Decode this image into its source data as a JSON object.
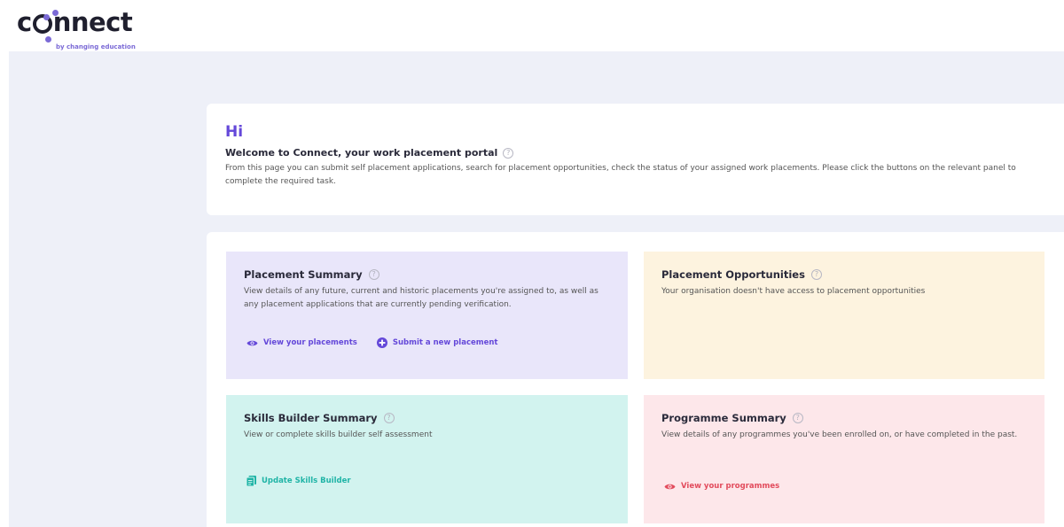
{
  "brand": {
    "logo_text_a": "c",
    "logo_text_b": "nnect",
    "tagline": "by changing education",
    "accent": "#6448d9"
  },
  "welcome": {
    "greeting": "Hi",
    "title": "Welcome to Connect, your work placement portal",
    "description": "From this page you can submit self placement applications, search for placement opportunities, check the status of your assigned work placements. Please click the buttons on the relevant panel to complete the required task."
  },
  "panels": {
    "placement_summary": {
      "title": "Placement Summary",
      "description": "View details of any future, current and historic placements you're assigned to, as well as any placement applications that are currently pending verification.",
      "actions": [
        {
          "label": "View your placements",
          "icon": "eye-icon"
        },
        {
          "label": "Submit a new placement",
          "icon": "plus-circle-icon"
        }
      ],
      "color": "#e9e6fa"
    },
    "placement_opportunities": {
      "title": "Placement Opportunities",
      "description": "Your organisation doesn't have access to placement opportunities",
      "color": "#fdf3df"
    },
    "skills_builder": {
      "title": "Skills Builder Summary",
      "description": "View or complete skills builder self assessment",
      "actions": [
        {
          "label": "Update Skills Builder",
          "icon": "document-icon"
        }
      ],
      "color": "#d2f3ef"
    },
    "programme_summary": {
      "title": "Programme Summary",
      "description": "View details of any programmes you've been enrolled on, or have completed in the past.",
      "actions": [
        {
          "label": "View your programmes",
          "icon": "eye-icon"
        }
      ],
      "color": "#fde7ea"
    }
  },
  "help_glyph": "?"
}
